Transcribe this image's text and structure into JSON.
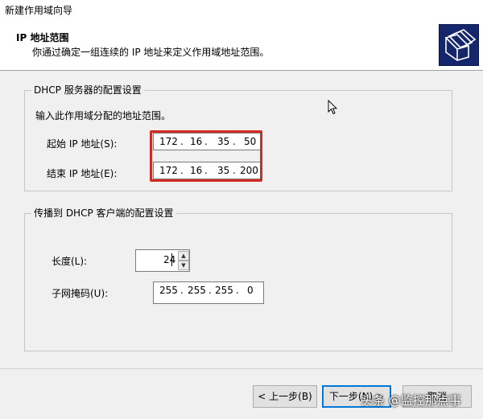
{
  "window": {
    "title": "新建作用域向导"
  },
  "header": {
    "title": "IP 地址范围",
    "subtitle": "你通过确定一组连续的 IP 地址来定义作用域地址范围。",
    "icon": "folders-icon"
  },
  "config_group": {
    "legend": "DHCP 服务器的配置设置",
    "instruction": "输入此作用域分配的地址范围。",
    "start_label": "起始 IP 地址(S):",
    "start_ip": [
      "172",
      "16",
      "35",
      "50"
    ],
    "end_label": "结束 IP 地址(E):",
    "end_ip": [
      "172",
      "16",
      "35",
      "200"
    ]
  },
  "propagate_group": {
    "legend": "传播到 DHCP 客户端的配置设置",
    "length_label": "长度(L):",
    "length_value": "24",
    "mask_label": "子网掩码(U):",
    "mask": [
      "255",
      "255",
      "255",
      "0"
    ]
  },
  "buttons": {
    "back": "< 上一步(B)",
    "next": "下一步(N) >",
    "cancel": "取消"
  },
  "watermark": "头条 @监控那点事",
  "colors": {
    "highlight": "#d42a26",
    "icon_bg": "#15266a",
    "accent": "#0078d7"
  }
}
